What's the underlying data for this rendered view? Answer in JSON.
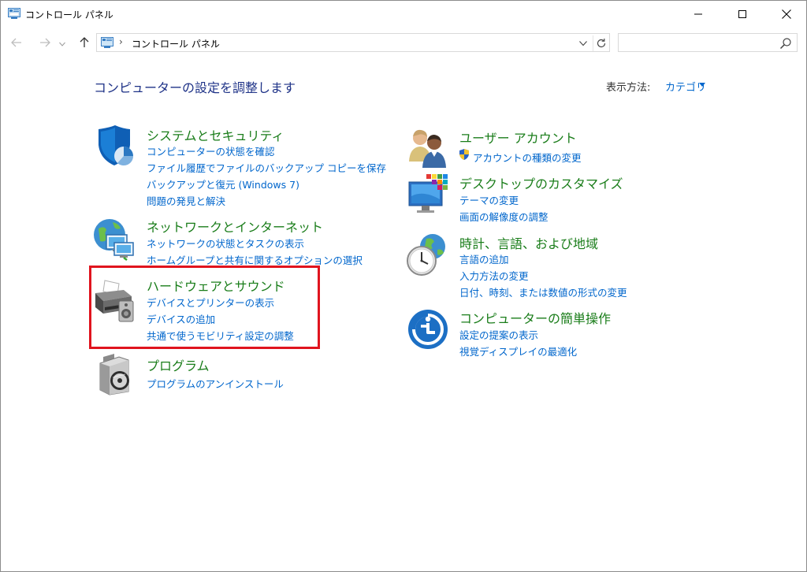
{
  "window": {
    "title": "コントロール パネル"
  },
  "address": {
    "crumb": "コントロール パネル",
    "separator": "›",
    "search_placeholder": ""
  },
  "content": {
    "heading": "コンピューターの設定を調整します",
    "view_by_label": "表示方法:",
    "view_by_value": "カテゴリ"
  },
  "categories": {
    "system": {
      "title": "システムとセキュリティ",
      "links": [
        "コンピューターの状態を確認",
        "ファイル履歴でファイルのバックアップ コピーを保存",
        "バックアップと復元 (Windows 7)",
        "問題の発見と解決"
      ],
      "icon": "shield-icon"
    },
    "network": {
      "title": "ネットワークとインターネット",
      "links": [
        "ネットワークの状態とタスクの表示",
        "ホームグループと共有に関するオプションの選択"
      ],
      "icon": "network-globe-icon"
    },
    "hardware": {
      "title": "ハードウェアとサウンド",
      "links": [
        "デバイスとプリンターの表示",
        "デバイスの追加",
        "共通で使うモビリティ設定の調整"
      ],
      "icon": "printer-icon"
    },
    "programs": {
      "title": "プログラム",
      "links": [
        "プログラムのアンインストール"
      ],
      "icon": "program-disc-icon"
    },
    "accounts": {
      "title": "ユーザー アカウント",
      "links": [
        "アカウントの種類の変更"
      ],
      "icon": "users-icon"
    },
    "appearance": {
      "title": "デスクトップのカスタマイズ",
      "links": [
        "テーマの変更",
        "画面の解像度の調整"
      ],
      "icon": "monitor-palette-icon"
    },
    "clock": {
      "title": "時計、言語、および地域",
      "links": [
        "言語の追加",
        "入力方法の変更",
        "日付、時刻、または数値の形式の変更"
      ],
      "icon": "clock-globe-icon"
    },
    "ease": {
      "title": "コンピューターの簡単操作",
      "links": [
        "設定の提案の表示",
        "視覚ディスプレイの最適化"
      ],
      "icon": "ease-of-access-icon"
    }
  },
  "colors": {
    "heading": "#1e3287",
    "category_title": "#1a7d1a",
    "link": "#0066cc",
    "highlight": "#e0141e"
  }
}
